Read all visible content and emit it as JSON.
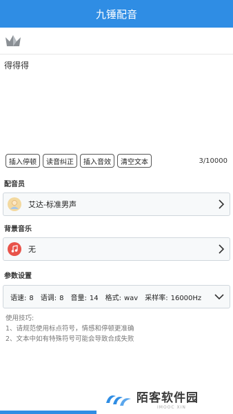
{
  "header": {
    "title": "九锤配音"
  },
  "editor": {
    "text": "得得得"
  },
  "toolbar": {
    "insert_pause": "插入停顿",
    "pronunciation_fix": "读音纠正",
    "insert_effect": "插入音效",
    "clear_text": "清空文本",
    "counter": "3/10000"
  },
  "voice": {
    "label": "配音员",
    "selected": "艾达-标准男声"
  },
  "music": {
    "label": "背景音乐",
    "selected": "无"
  },
  "params": {
    "label": "参数设置",
    "speed_label": "语速:",
    "speed_value": "8",
    "pitch_label": "语调:",
    "pitch_value": "8",
    "volume_label": "音量:",
    "volume_value": "14",
    "format_label": "格式:",
    "format_value": "wav",
    "rate_label": "采样率:",
    "rate_value": "16000Hz"
  },
  "tips": {
    "title": "使用技巧:",
    "line1": "1、请规范使用标点符号，情感和停顿更准确",
    "line2": "2、文本中如有特殊符号可能会导致合成失败"
  },
  "watermark": {
    "title": "陌客软件园",
    "subtitle": "IMOOC XIN"
  },
  "colors": {
    "accent": "#2f8de4"
  },
  "icons": {
    "crown": "crown-icon",
    "voice_avatar": "avatar-icon",
    "music": "music-icon",
    "chevron_right": "chevron-right-icon",
    "chevron_down": "chevron-down-icon"
  }
}
